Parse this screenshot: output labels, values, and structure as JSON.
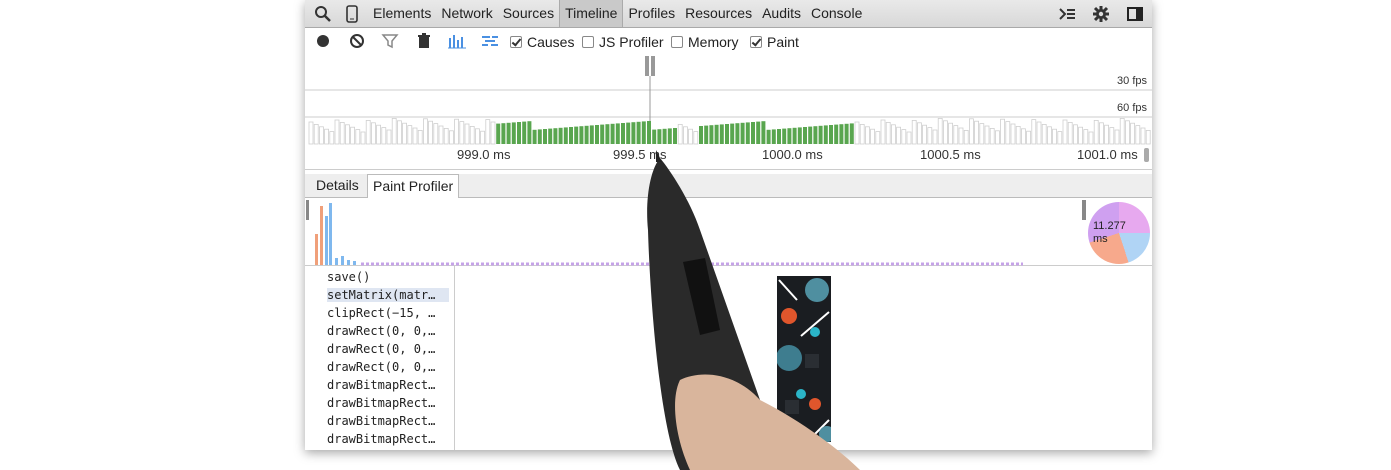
{
  "toolbar": {
    "tabs": [
      "Elements",
      "Network",
      "Sources",
      "Timeline",
      "Profiles",
      "Resources",
      "Audits",
      "Console"
    ],
    "selected_tab": "Timeline",
    "icons": [
      "search-icon",
      "device-icon",
      "console-drawer-icon",
      "gear-icon",
      "dock-icon"
    ]
  },
  "controls": {
    "icons": [
      "record-icon",
      "clear-icon",
      "filter-icon",
      "trash-icon",
      "bars-icon",
      "waterfall-icon"
    ],
    "checkboxes": [
      {
        "label": "Causes",
        "checked": true
      },
      {
        "label": "JS Profiler",
        "checked": false
      },
      {
        "label": "Memory",
        "checked": false
      },
      {
        "label": "Paint",
        "checked": true
      }
    ]
  },
  "overview": {
    "fps30": "30 fps",
    "fps60": "60 fps"
  },
  "ruler": [
    "999.0 ms",
    "999.5 ms",
    "1000.0 ms",
    "1000.5 ms",
    "1001.0 ms"
  ],
  "subtabs": [
    "Details",
    "Paint Profiler"
  ],
  "paint_profiler": {
    "total_value": "11.277",
    "total_unit": "ms",
    "commands": [
      {
        "text": "save()",
        "expandable": false
      },
      {
        "text": "setMatrix(matr…",
        "expandable": true,
        "selected": true
      },
      {
        "text": "clipRect(−15, …",
        "expandable": true
      },
      {
        "text": "drawRect(0, 0,…",
        "expandable": true
      },
      {
        "text": "drawRect(0, 0,…",
        "expandable": true
      },
      {
        "text": "drawRect(0, 0,…",
        "expandable": true
      },
      {
        "text": "drawBitmapRect…",
        "expandable": true
      },
      {
        "text": "drawBitmapRect…",
        "expandable": true
      },
      {
        "text": "drawBitmapRect…",
        "expandable": true
      },
      {
        "text": "drawBitmapRect…",
        "expandable": true
      }
    ]
  },
  "colors": {
    "accent": "#4a90e2",
    "frame_green": "#59a64f",
    "paint_purple": "#c6a3e8"
  }
}
